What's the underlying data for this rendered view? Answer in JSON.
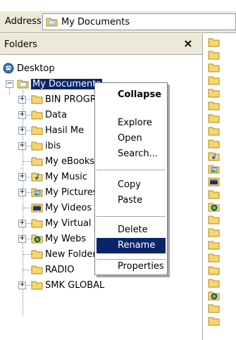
{
  "address": {
    "label": "Address",
    "value": "My Documents",
    "icon": "my-documents-folder-icon"
  },
  "folders": {
    "title": "Folders",
    "close_symbol": "×"
  },
  "tree": {
    "desktop": "Desktop",
    "my_documents": "My Documents",
    "children": [
      {
        "label": "BIN PROGRAM",
        "icon": "folder-icon",
        "expandable": true
      },
      {
        "label": "Data",
        "icon": "folder-icon",
        "expandable": true
      },
      {
        "label": "Hasil Me",
        "icon": "folder-icon",
        "expandable": true
      },
      {
        "label": "ibis",
        "icon": "folder-icon",
        "expandable": true
      },
      {
        "label": "My eBooks",
        "icon": "folder-icon",
        "expandable": false
      },
      {
        "label": "My Music",
        "icon": "music-folder-icon",
        "expandable": true
      },
      {
        "label": "My Pictures",
        "icon": "pictures-folder-icon",
        "expandable": true
      },
      {
        "label": "My Videos",
        "icon": "videos-folder-icon",
        "expandable": false
      },
      {
        "label": "My Virtual",
        "icon": "folder-icon",
        "expandable": true
      },
      {
        "label": "My Webs",
        "icon": "web-folder-icon",
        "expandable": true
      },
      {
        "label": "New Folder",
        "icon": "folder-icon",
        "expandable": false
      },
      {
        "label": "RADIO",
        "icon": "folder-icon",
        "expandable": false
      },
      {
        "label": "SMK GLOBAL",
        "icon": "folder-icon",
        "expandable": true
      }
    ]
  },
  "context_menu": {
    "items": [
      {
        "label": "Collapse",
        "bold": true
      },
      {
        "label": "Explore"
      },
      {
        "label": "Open"
      },
      {
        "label": "Search..."
      },
      {
        "label": "Copy"
      },
      {
        "label": "Paste"
      },
      {
        "label": "Delete"
      },
      {
        "label": "Rename",
        "highlighted": true
      },
      {
        "label": "Properties"
      }
    ]
  },
  "colors": {
    "selection": "#0a246a",
    "folder_yellow": "#f5d76e",
    "toolbar_bg": "#ece9d8"
  }
}
